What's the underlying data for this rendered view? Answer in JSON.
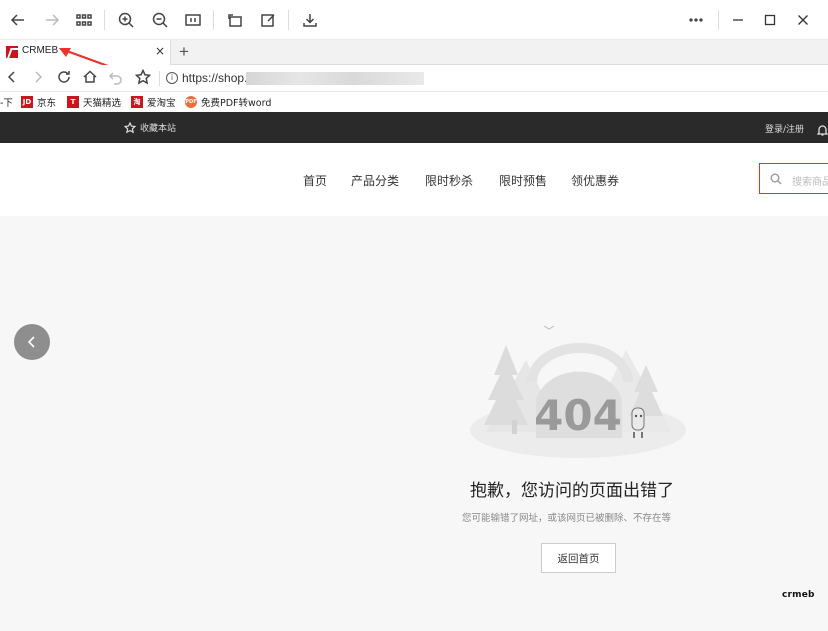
{
  "browser": {
    "tab_title": "CRMEB",
    "tab_close": "×",
    "new_tab": "+",
    "url": "https://shop.",
    "info_glyph": "i"
  },
  "bookmarks": [
    {
      "label": "-下",
      "icon": "",
      "color": ""
    },
    {
      "label": "京东",
      "icon": "JD",
      "color": "#c8161d"
    },
    {
      "label": "天猫精选",
      "icon": "T",
      "color": "#c8161d"
    },
    {
      "label": "爱淘宝",
      "icon": "淘",
      "color": "#c8161d"
    },
    {
      "label": "免费PDF转word",
      "icon": "PDF",
      "color": "#f26b3a"
    }
  ],
  "site_top": {
    "favorite": "收藏本站",
    "login": "登录/注册"
  },
  "nav": {
    "items": [
      "首页",
      "产品分类",
      "限时秒杀",
      "限时预售",
      "领优惠券"
    ],
    "search_placeholder": "搜索商品"
  },
  "error_page": {
    "code": "404",
    "title": "抱歉，您访问的页面出错了",
    "subtitle": "您可能输错了网址，或该网页已被删除、不存在等",
    "home_button": "返回首页"
  },
  "brand": "crmeb",
  "colors": {
    "accent": "#e93323",
    "topbar": "#2a2a2a",
    "annotation_arrow": "#e8322b"
  }
}
